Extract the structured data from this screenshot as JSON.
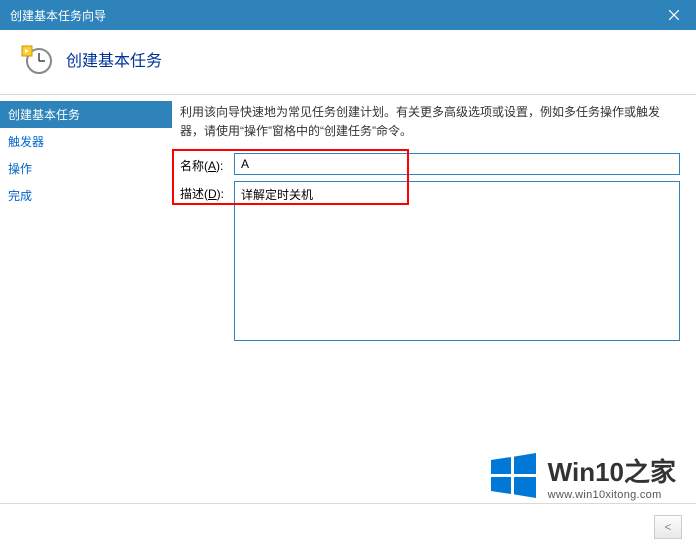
{
  "window": {
    "title": "创建基本任务向导"
  },
  "header": {
    "heading": "创建基本任务"
  },
  "sidebar": {
    "items": [
      {
        "label": "创建基本任务",
        "active": true
      },
      {
        "label": "触发器",
        "active": false
      },
      {
        "label": "操作",
        "active": false
      },
      {
        "label": "完成",
        "active": false
      }
    ]
  },
  "main": {
    "intro": "利用该向导快速地为常见任务创建计划。有关更多高级选项或设置，例如多任务操作或触发器，请使用“操作”窗格中的“创建任务”命令。",
    "name_label_prefix": "名称(",
    "name_label_key": "A",
    "name_label_suffix": "):",
    "name_value": "A",
    "desc_label_prefix": "描述(",
    "desc_label_key": "D",
    "desc_label_suffix": "):",
    "desc_value": "详解定时关机"
  },
  "footer": {
    "back": "<"
  },
  "watermark": {
    "brand": "Win10之家",
    "url": "www.win10xitong.com"
  }
}
